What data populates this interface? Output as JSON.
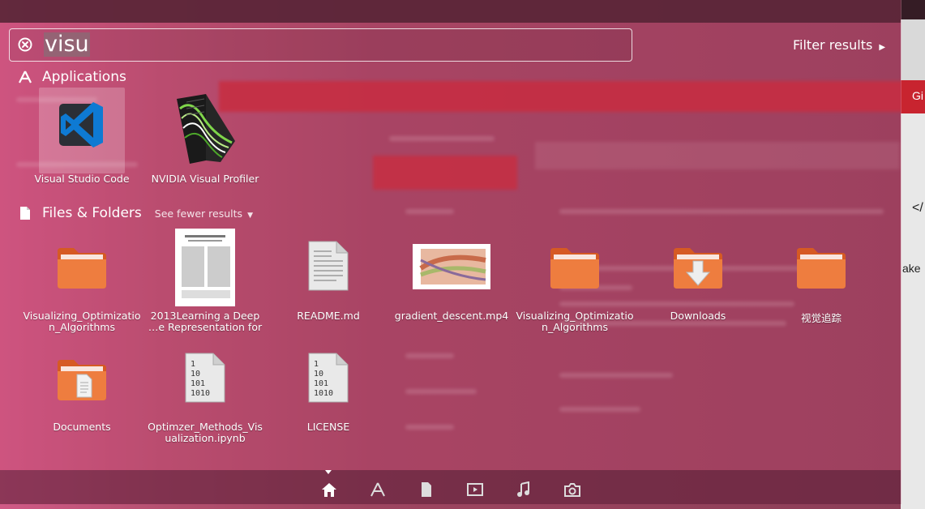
{
  "search": {
    "query": "visu"
  },
  "filter": {
    "label": "Filter results"
  },
  "applications": {
    "header": "Applications",
    "items": [
      {
        "label": "Visual Studio Code",
        "icon": "vscode-icon"
      },
      {
        "label": "NVIDIA Visual Profiler",
        "icon": "nvidia-profiler-icon"
      }
    ]
  },
  "files": {
    "header": "Files & Folders",
    "see_fewer": "See fewer results",
    "items": [
      {
        "label": "Visualizing_Optimizatio n_Algorithms",
        "icon": "folder-icon"
      },
      {
        "label": "2013Learning a Deep …e Representation for",
        "icon": "pdf-thumbnail-icon"
      },
      {
        "label": "README.md",
        "icon": "text-file-icon"
      },
      {
        "label": "gradient_descent.mp4",
        "icon": "video-thumbnail-icon"
      },
      {
        "label": "Visualizing_Optimizatio n_Algorithms",
        "icon": "folder-icon"
      },
      {
        "label": "Downloads",
        "icon": "downloads-folder-icon"
      },
      {
        "label": "视觉追踪",
        "icon": "folder-icon"
      },
      {
        "label": "Documents",
        "icon": "documents-folder-icon"
      },
      {
        "label": "Optimzer_Methods_Vis ualization.ipynb",
        "icon": "binary-file-icon"
      },
      {
        "label": "LICENSE",
        "icon": "binary-file-icon"
      }
    ]
  },
  "background": {
    "right_text_1": "Gi",
    "right_text_2": "</",
    "right_text_3": "ake"
  },
  "colors": {
    "accent": "#c8467a",
    "folder": "#e8743a",
    "red_band": "#c8242f"
  }
}
